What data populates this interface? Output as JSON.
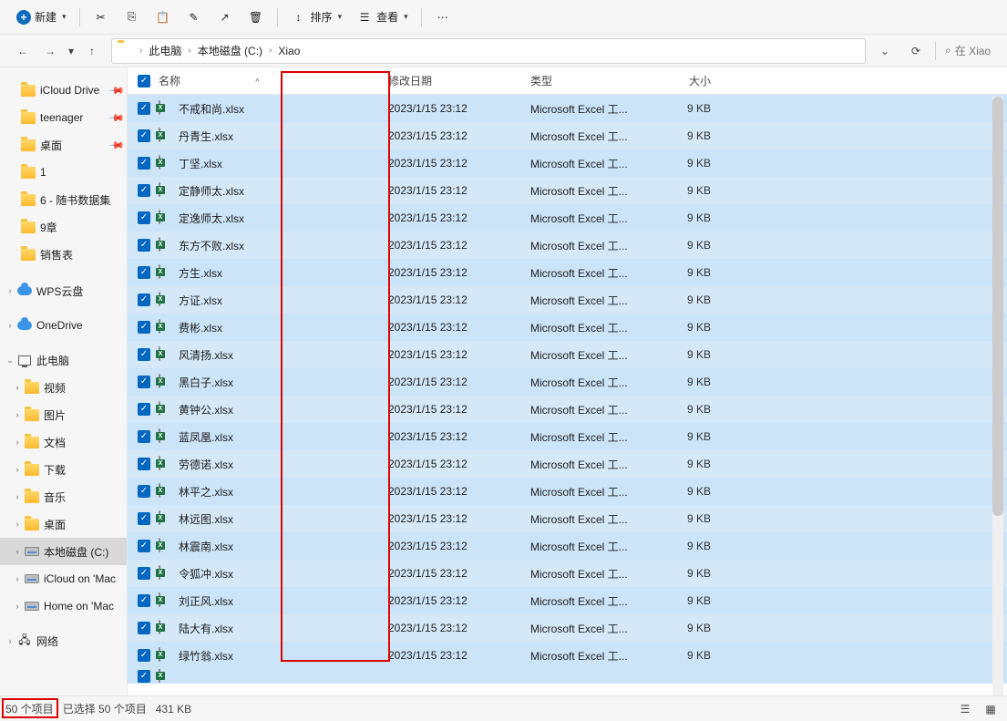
{
  "toolbar": {
    "new_label": "新建",
    "sort_label": "排序",
    "view_label": "查看"
  },
  "breadcrumb": [
    "此电脑",
    "本地磁盘 (C:)",
    "Xiao"
  ],
  "search_placeholder": "在 Xiao",
  "sidebar": {
    "quick": [
      {
        "label": "iCloud Drive",
        "pinned": true,
        "icon": "folder"
      },
      {
        "label": "teenager",
        "pinned": true,
        "icon": "folder"
      },
      {
        "label": "桌面",
        "pinned": true,
        "icon": "folder-blue"
      },
      {
        "label": "1",
        "pinned": false,
        "icon": "folder"
      },
      {
        "label": "6 - 随书数据集",
        "pinned": false,
        "icon": "folder"
      },
      {
        "label": "9章",
        "pinned": false,
        "icon": "folder"
      },
      {
        "label": "销售表",
        "pinned": false,
        "icon": "folder"
      }
    ],
    "providers": [
      {
        "label": "WPS云盘",
        "icon": "cloud",
        "exp": "›"
      },
      {
        "label": "OneDrive",
        "icon": "cloud",
        "exp": "›"
      }
    ],
    "thispc_label": "此电脑",
    "thispc_items": [
      {
        "label": "视频",
        "icon": "folder"
      },
      {
        "label": "图片",
        "icon": "folder"
      },
      {
        "label": "文档",
        "icon": "folder"
      },
      {
        "label": "下载",
        "icon": "folder"
      },
      {
        "label": "音乐",
        "icon": "folder"
      },
      {
        "label": "桌面",
        "icon": "folder"
      },
      {
        "label": "本地磁盘 (C:)",
        "icon": "drive",
        "selected": true
      },
      {
        "label": "iCloud on 'Mac",
        "icon": "drive"
      },
      {
        "label": "Home on 'Mac",
        "icon": "drive"
      }
    ],
    "network_label": "网络"
  },
  "columns": {
    "name": "名称",
    "date": "修改日期",
    "type": "类型",
    "size": "大小"
  },
  "files": [
    {
      "name": "不戒和尚.xlsx",
      "date": "2023/1/15 23:12",
      "type": "Microsoft Excel 工...",
      "size": "9 KB"
    },
    {
      "name": "丹青生.xlsx",
      "date": "2023/1/15 23:12",
      "type": "Microsoft Excel 工...",
      "size": "9 KB"
    },
    {
      "name": "丁坚.xlsx",
      "date": "2023/1/15 23:12",
      "type": "Microsoft Excel 工...",
      "size": "9 KB"
    },
    {
      "name": "定静师太.xlsx",
      "date": "2023/1/15 23:12",
      "type": "Microsoft Excel 工...",
      "size": "9 KB"
    },
    {
      "name": "定逸师太.xlsx",
      "date": "2023/1/15 23:12",
      "type": "Microsoft Excel 工...",
      "size": "9 KB"
    },
    {
      "name": "东方不败.xlsx",
      "date": "2023/1/15 23:12",
      "type": "Microsoft Excel 工...",
      "size": "9 KB"
    },
    {
      "name": "方生.xlsx",
      "date": "2023/1/15 23:12",
      "type": "Microsoft Excel 工...",
      "size": "9 KB"
    },
    {
      "name": "方证.xlsx",
      "date": "2023/1/15 23:12",
      "type": "Microsoft Excel 工...",
      "size": "9 KB"
    },
    {
      "name": "费彬.xlsx",
      "date": "2023/1/15 23:12",
      "type": "Microsoft Excel 工...",
      "size": "9 KB"
    },
    {
      "name": "风清扬.xlsx",
      "date": "2023/1/15 23:12",
      "type": "Microsoft Excel 工...",
      "size": "9 KB"
    },
    {
      "name": "黑白子.xlsx",
      "date": "2023/1/15 23:12",
      "type": "Microsoft Excel 工...",
      "size": "9 KB"
    },
    {
      "name": "黄钟公.xlsx",
      "date": "2023/1/15 23:12",
      "type": "Microsoft Excel 工...",
      "size": "9 KB"
    },
    {
      "name": "蓝凤凰.xlsx",
      "date": "2023/1/15 23:12",
      "type": "Microsoft Excel 工...",
      "size": "9 KB"
    },
    {
      "name": "劳德诺.xlsx",
      "date": "2023/1/15 23:12",
      "type": "Microsoft Excel 工...",
      "size": "9 KB"
    },
    {
      "name": "林平之.xlsx",
      "date": "2023/1/15 23:12",
      "type": "Microsoft Excel 工...",
      "size": "9 KB"
    },
    {
      "name": "林远图.xlsx",
      "date": "2023/1/15 23:12",
      "type": "Microsoft Excel 工...",
      "size": "9 KB"
    },
    {
      "name": "林震南.xlsx",
      "date": "2023/1/15 23:12",
      "type": "Microsoft Excel 工...",
      "size": "9 KB"
    },
    {
      "name": "令狐冲.xlsx",
      "date": "2023/1/15 23:12",
      "type": "Microsoft Excel 工...",
      "size": "9 KB"
    },
    {
      "name": "刘正风.xlsx",
      "date": "2023/1/15 23:12",
      "type": "Microsoft Excel 工...",
      "size": "9 KB"
    },
    {
      "name": "陆大有.xlsx",
      "date": "2023/1/15 23:12",
      "type": "Microsoft Excel 工...",
      "size": "9 KB"
    },
    {
      "name": "绿竹翁.xlsx",
      "date": "2023/1/15 23:12",
      "type": "Microsoft Excel 工...",
      "size": "9 KB"
    }
  ],
  "status": {
    "count": "50 个项目",
    "selected": "已选择 50 个项目",
    "size": "431 KB"
  }
}
